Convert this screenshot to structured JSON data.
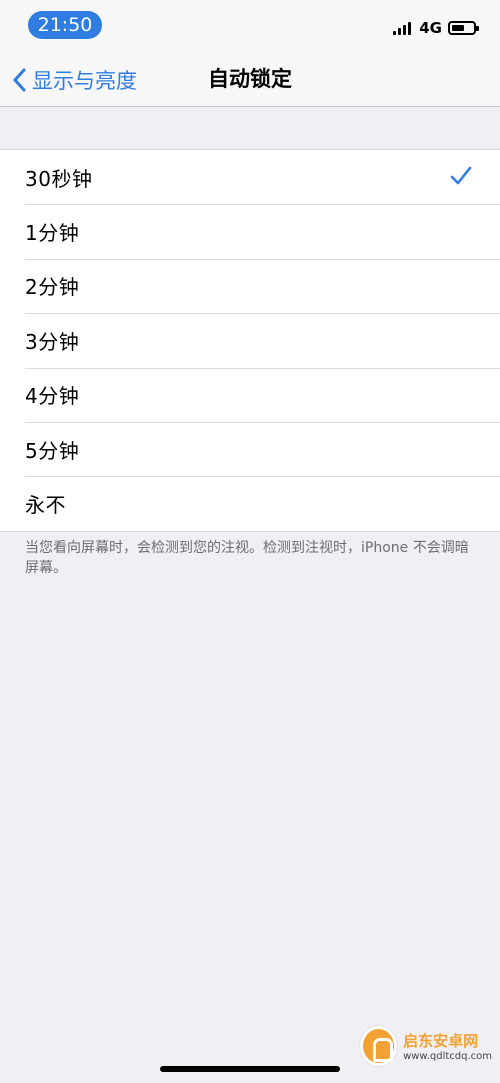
{
  "status_bar": {
    "time": "21:50",
    "network": "4G",
    "icons": [
      "signal-icon",
      "battery-icon"
    ]
  },
  "nav": {
    "back_label": "显示与亮度",
    "title": "自动锁定"
  },
  "options": [
    {
      "label": "30秒钟",
      "selected": true
    },
    {
      "label": "1分钟",
      "selected": false
    },
    {
      "label": "2分钟",
      "selected": false
    },
    {
      "label": "3分钟",
      "selected": false
    },
    {
      "label": "4分钟",
      "selected": false
    },
    {
      "label": "5分钟",
      "selected": false
    },
    {
      "label": "永不",
      "selected": false
    }
  ],
  "footer_note": "当您看向屏幕时，会检测到您的注视。检测到注视时，iPhone 不会调暗屏幕。",
  "watermark": {
    "title": "启东安卓网",
    "url": "www.qdltcdq.com"
  },
  "colors": {
    "accent": "#2f7de1",
    "background": "#efeff4",
    "footer_text": "#6d6d72"
  }
}
